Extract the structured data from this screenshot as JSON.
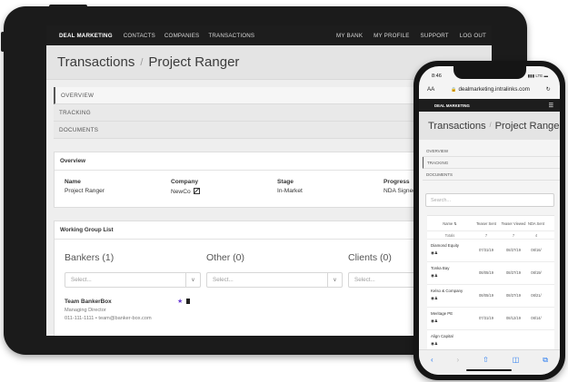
{
  "tablet": {
    "nav": {
      "brand": "DEAL MARKETING",
      "left_items": [
        "CONTACTS",
        "COMPANIES",
        "TRANSACTIONS"
      ],
      "right_items": [
        "MY BANK",
        "MY PROFILE",
        "SUPPORT",
        "LOG OUT"
      ]
    },
    "breadcrumb": {
      "section": "Transactions",
      "separator": "/",
      "current": "Project Ranger"
    },
    "tabs": [
      "OVERVIEW",
      "TRACKING",
      "DOCUMENTS"
    ],
    "overview": {
      "heading": "Overview",
      "fields": [
        {
          "label": "Name",
          "value": "Project Ranger"
        },
        {
          "label": "Company",
          "value": "NewCo"
        },
        {
          "label": "Stage",
          "value": "In-Market"
        },
        {
          "label": "Progress",
          "value": "NDA Signed"
        }
      ]
    },
    "working_group": {
      "heading": "Working Group List",
      "columns": [
        {
          "title": "Bankers (1)",
          "placeholder": "Select..."
        },
        {
          "title": "Other (0)",
          "placeholder": "Select..."
        },
        {
          "title": "Clients (0)",
          "placeholder": "Select..."
        }
      ],
      "member": {
        "name": "Team BankerBox",
        "role": "Managing Director",
        "contact": "011-111-1111 • team@banker-box.com"
      }
    }
  },
  "phone": {
    "status": {
      "time": "8:46",
      "signal": "LTE"
    },
    "url": {
      "text_size": "AA",
      "domain": "dealmarketing.intralinks.com"
    },
    "nav": {
      "brand": "DEAL MARKETING"
    },
    "breadcrumb": {
      "section": "Transactions",
      "separator": "/",
      "current": "Project Ranger"
    },
    "tabs": [
      "OVERVIEW",
      "TRACKING",
      "DOCUMENTS"
    ],
    "search_placeholder": "Search...",
    "table": {
      "headers": [
        "Name ⇅",
        "Teaser Sent",
        "Teaser Viewed",
        "NDA Sent"
      ],
      "totals_label": "Totals",
      "totals": [
        "7",
        "7",
        "4"
      ],
      "rows": [
        {
          "name": "Diamond Equity",
          "values": [
            "07/31/19",
            "08/27/19",
            "08/16/"
          ]
        },
        {
          "name": "Tonka Bay",
          "values": [
            "08/05/19",
            "08/27/19",
            "08/19/"
          ]
        },
        {
          "name": "Kelso & Company",
          "values": [
            "08/05/19",
            "08/27/19",
            "08/21/"
          ]
        },
        {
          "name": "Meritage PE",
          "values": [
            "07/31/19",
            "08/12/19",
            "08/14/"
          ]
        },
        {
          "name": "Align Capital",
          "values": [
            "",
            "",
            ""
          ]
        }
      ]
    }
  }
}
